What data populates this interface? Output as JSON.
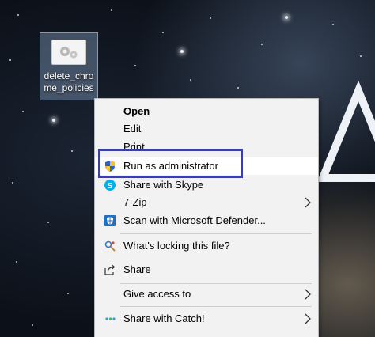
{
  "desktop": {
    "icon_label": "delete_chrome_policies",
    "icon_name": "batch-file-gear-icon"
  },
  "context_menu": {
    "items": [
      {
        "label": "Open",
        "bold": true
      },
      {
        "label": "Edit"
      },
      {
        "label": "Print"
      },
      {
        "label": "Run as administrator",
        "icon": "uac-shield-icon"
      },
      {
        "label": "Share with Skype",
        "icon": "skype-icon"
      },
      {
        "label": "7-Zip",
        "submenu": true
      },
      {
        "label": "Scan with Microsoft Defender...",
        "icon": "defender-shield-icon"
      },
      {
        "label": "What's locking this file?",
        "icon": "lock-search-icon"
      },
      {
        "label": "Share",
        "icon": "share-icon"
      },
      {
        "label": "Give access to",
        "submenu": true
      },
      {
        "label": "Share with Catch!",
        "icon": "catch-dots-icon",
        "submenu": true
      }
    ]
  },
  "colors": {
    "highlight_border": "#3a3fa0",
    "menu_background": "#f2f2f2",
    "skype_blue": "#00aff0",
    "defender_blue": "#1f6fc5"
  }
}
